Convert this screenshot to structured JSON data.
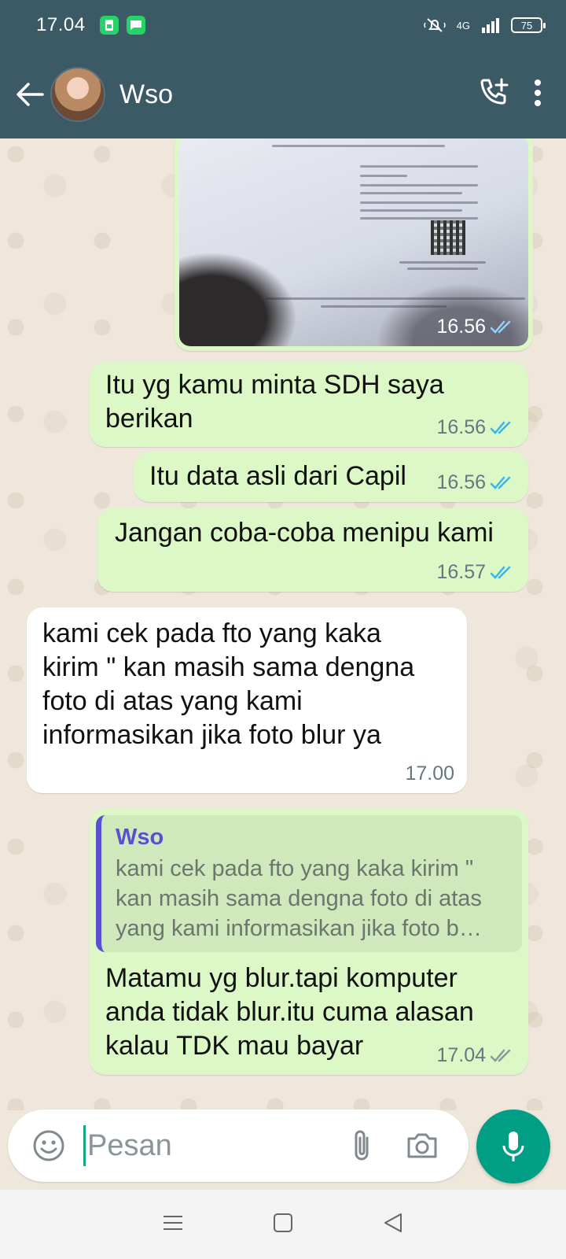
{
  "status_bar": {
    "time": "17.04",
    "network": "4G",
    "battery": "75"
  },
  "header": {
    "contact_name": "Wso",
    "icons": [
      "back-arrow-icon",
      "add-call-icon",
      "more-vert-icon"
    ]
  },
  "messages": [
    {
      "type": "image",
      "direction": "out",
      "time": "16.56",
      "status": "read"
    },
    {
      "type": "text",
      "direction": "out",
      "text": "Itu yg kamu minta SDH saya berikan",
      "time": "16.56",
      "status": "read"
    },
    {
      "type": "text",
      "direction": "out",
      "text": "Itu data asli dari Capil",
      "time": "16.56",
      "status": "read"
    },
    {
      "type": "text",
      "direction": "out",
      "text": "Jangan coba-coba menipu kami",
      "time": "16.57",
      "status": "read"
    },
    {
      "type": "text",
      "direction": "in",
      "text": "kami cek pada fto yang kaka kirim \" kan masih sama dengna foto di atas yang kami informasikan jika foto blur ya",
      "time": "17.00"
    },
    {
      "type": "reply",
      "direction": "out",
      "quote_author": "Wso",
      "quote_text": "kami cek pada fto yang kaka kirim \" kan masih sama dengna foto di atas yang kami informasikan jika foto b…",
      "text": "Matamu yg blur.tapi komputer anda tidak blur.itu cuma alasan kalau TDK mau bayar",
      "time": "17.04",
      "status": "delivered"
    }
  ],
  "composer": {
    "placeholder": "Pesan"
  },
  "colors": {
    "header_bg": "#3c5a66",
    "outgoing_bubble": "#dcf8c6",
    "incoming_bubble": "#ffffff",
    "read_tick": "#34b7f1",
    "mic_button": "#009e84",
    "quote_accent": "#5b4fd1"
  }
}
